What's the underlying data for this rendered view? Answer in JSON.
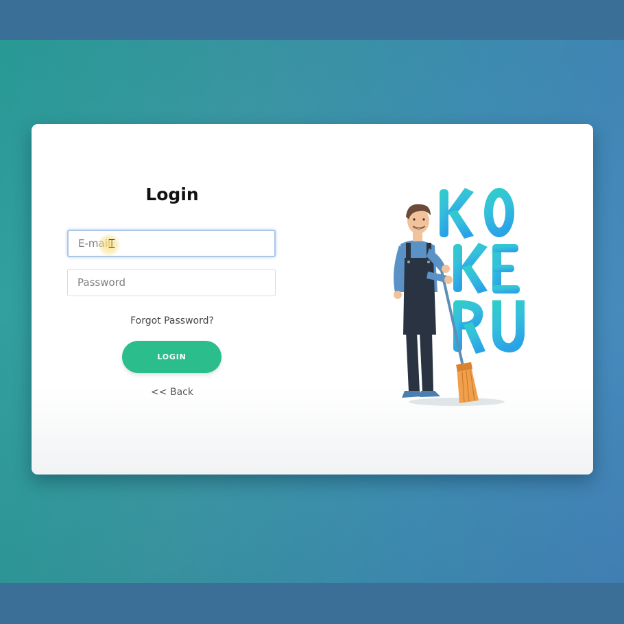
{
  "login": {
    "title": "Login",
    "email_placeholder": "E-mail",
    "password_placeholder": "Password",
    "forgot_password": "Forgot Password?",
    "button_label": "LOGIN",
    "back_link": "<< Back"
  },
  "illustration": {
    "brand_text": "KOKERU",
    "icon": "cleaner-with-broom-illustration"
  },
  "colors": {
    "accent": "#2bbd8c",
    "background_left": "#2a9f9a",
    "background_right": "#4486bd",
    "frame_band": "#3a6f97"
  }
}
